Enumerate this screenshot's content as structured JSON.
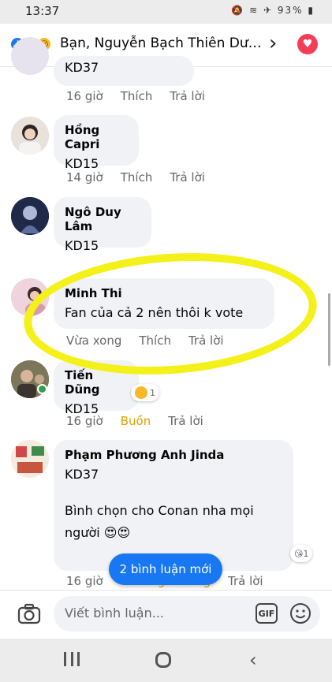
{
  "status_bar": {
    "time": "13:37",
    "battery": "93%",
    "icons": "🔕 ≋ ✈"
  },
  "header": {
    "reactions": [
      "like",
      "love",
      "care"
    ],
    "title": "Bạn, Nguyễn Bạch Thiên Dươ..."
  },
  "comments": [
    {
      "author": "",
      "text": "KD37",
      "time": "16 giờ",
      "like": "Thích",
      "reply": "Trả lời"
    },
    {
      "author": "Hồng Capri",
      "text": "KD15",
      "time": "14 giờ",
      "like": "Thích",
      "reply": "Trả lời"
    },
    {
      "author": "Ngô Duy Lâm",
      "text": "KD15",
      "time": "",
      "like": "",
      "reply": ""
    },
    {
      "author": "Minh Thi",
      "text": "Fan của cả 2 nên thôi k vote",
      "time": "Vừa xong",
      "like": "Thích",
      "reply": "Trả lời"
    },
    {
      "author": "Tiến Dũng",
      "text": "KD15",
      "time": "16 giờ",
      "like": "Buồn",
      "reply": "Trả lời",
      "reaction_count": "1"
    },
    {
      "author": "Phạm Phương Anh Jinda",
      "text": "KD37",
      "text2": "Bình chọn cho Conan nha mọi người 😍😍",
      "time": "16 giờ",
      "like": "Thương thương",
      "reply": "Trả lời",
      "reaction_count": "1"
    }
  ],
  "new_comments_button": "2 bình luận mới",
  "composer": {
    "placeholder": "Viết bình luận...",
    "gif_label": "GIF"
  },
  "colors": {
    "accent": "#1877f2",
    "bubble": "#f0f2f5",
    "highlight": "#f4f01a"
  }
}
